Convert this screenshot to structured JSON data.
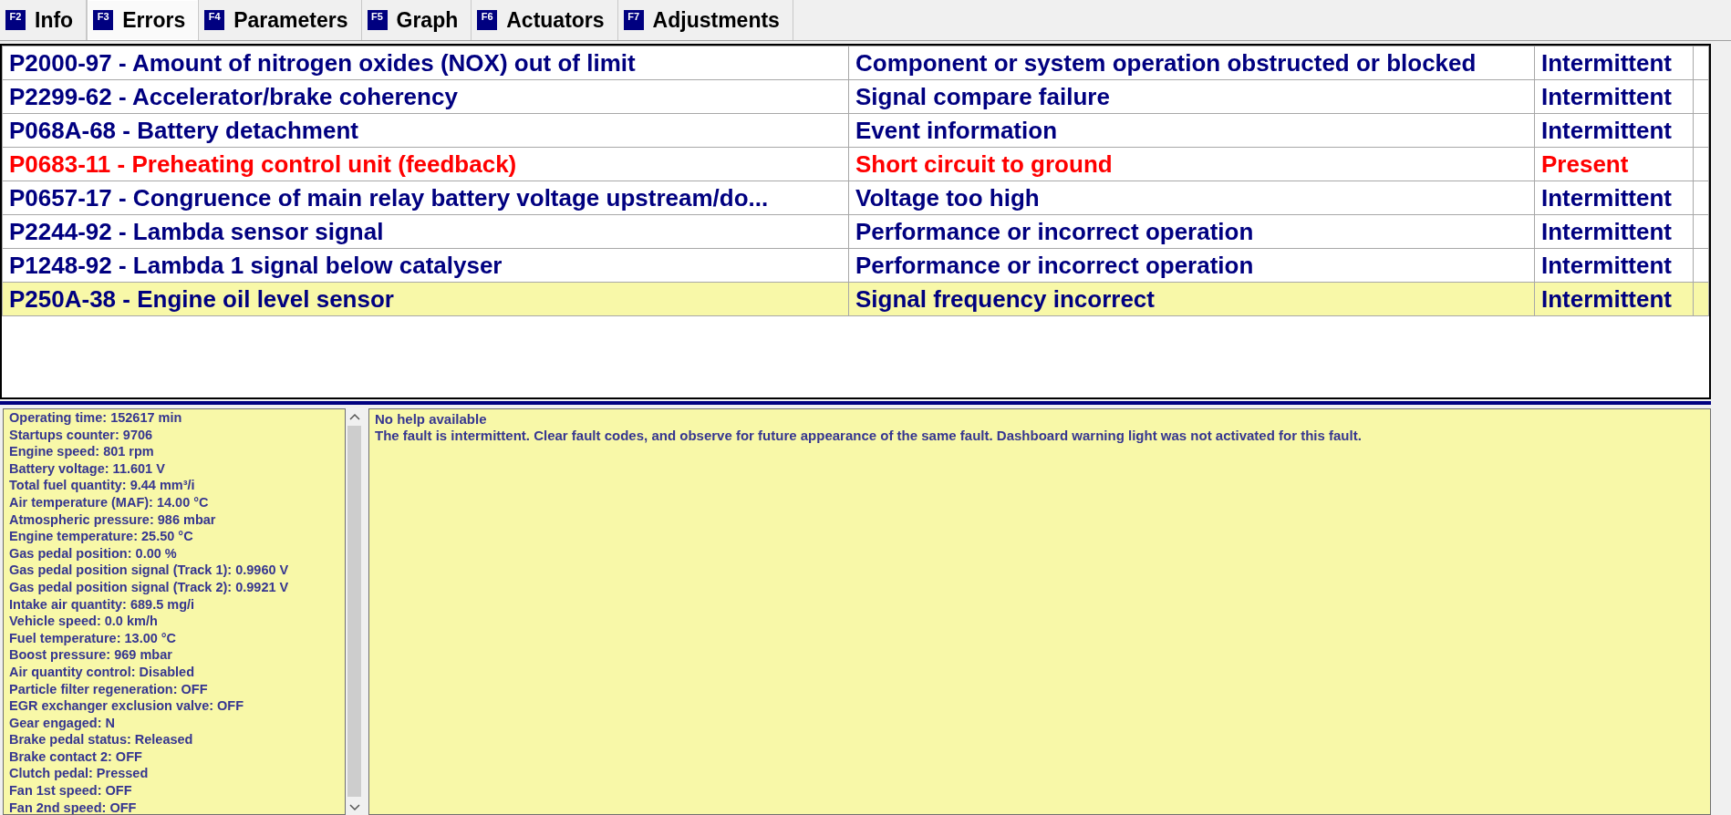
{
  "tabs": [
    {
      "key": "F2",
      "label": "Info",
      "selected": false
    },
    {
      "key": "F3",
      "label": "Errors",
      "selected": true
    },
    {
      "key": "F4",
      "label": "Parameters",
      "selected": false
    },
    {
      "key": "F5",
      "label": "Graph",
      "selected": false
    },
    {
      "key": "F6",
      "label": "Actuators",
      "selected": false
    },
    {
      "key": "F7",
      "label": "Adjustments",
      "selected": false
    }
  ],
  "faults": [
    {
      "code": "P2000-97 - Amount of nitrogen oxides (NOX) out of limit",
      "description": "Component or system operation obstructed or blocked",
      "status": "Intermittent",
      "color": "#000080",
      "selected": false
    },
    {
      "code": "P2299-62 - Accelerator/brake coherency",
      "description": "Signal compare failure",
      "status": "Intermittent",
      "color": "#000080",
      "selected": false
    },
    {
      "code": "P068A-68 - Battery detachment",
      "description": "Event information",
      "status": "Intermittent",
      "color": "#000080",
      "selected": false
    },
    {
      "code": "P0683-11 - Preheating control unit (feedback)",
      "description": "Short circuit to ground",
      "status": "Present",
      "color": "#ff0000",
      "selected": false
    },
    {
      "code": "P0657-17 - Congruence of main relay battery voltage upstream/do...",
      "description": "Voltage too high",
      "status": "Intermittent",
      "color": "#000080",
      "selected": false
    },
    {
      "code": "P2244-92 - Lambda sensor signal",
      "description": "Performance or incorrect operation",
      "status": "Intermittent",
      "color": "#000080",
      "selected": false
    },
    {
      "code": "P1248-92 - Lambda 1 signal below catalyser",
      "description": "Performance or incorrect operation",
      "status": "Intermittent",
      "color": "#000080",
      "selected": false
    },
    {
      "code": "P250A-38 - Engine oil level sensor",
      "description": "Signal frequency incorrect",
      "status": "Intermittent",
      "color": "#000080",
      "selected": true
    }
  ],
  "freeze_frame": [
    "Operating time: 152617 min",
    "Startups counter: 9706",
    "Engine speed: 801 rpm",
    "Battery voltage: 11.601 V",
    "Total fuel quantity: 9.44 mm³/i",
    "Air temperature (MAF): 14.00 °C",
    "Atmospheric pressure: 986 mbar",
    "Engine temperature: 25.50 °C",
    "Gas pedal position: 0.00 %",
    "Gas pedal position signal (Track 1): 0.9960 V",
    "Gas pedal position signal (Track 2): 0.9921 V",
    "Intake air quantity: 689.5 mg/i",
    "Vehicle speed: 0.0 km/h",
    "Fuel temperature: 13.00 °C",
    "Boost pressure: 969 mbar",
    "Air quantity control: Disabled",
    "Particle filter regeneration: OFF",
    "EGR exchanger exclusion valve: OFF",
    "Gear engaged: N",
    "Brake pedal status: Released",
    "Brake contact 2: OFF",
    "Clutch pedal: Pressed",
    "Fan 1st speed: OFF",
    "Fan 2nd speed: OFF"
  ],
  "help": {
    "title": "No help available",
    "text": "The fault is intermittent. Clear fault codes, and observe for future appearance of the same fault. Dashboard warning light was not activated for this fault."
  }
}
